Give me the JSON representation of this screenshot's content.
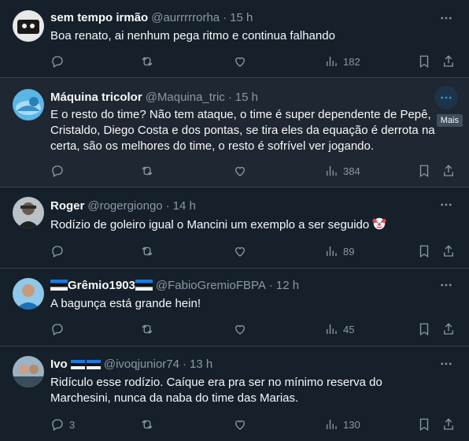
{
  "tooltip": "Mais",
  "tweets": [
    {
      "name": "sem tempo irmão",
      "handle": "@aurrrrrorha",
      "sep": "·",
      "time": "15 h",
      "text": "Boa renato, ai nenhum pega ritmo e continua falhando",
      "replies": "",
      "retweets": "",
      "likes": "",
      "views": "182"
    },
    {
      "name": "Máquina tricolor",
      "handle": "@Maquina_tric",
      "sep": "·",
      "time": "15 h",
      "text": "E o resto do time? Não tem ataque, o time é super dependente de Pepê, Cristaldo, Diego Costa e dos pontas, se tira eles da equação é derrota na certa, são os melhores do time, o resto é sofrível ver jogando.",
      "replies": "",
      "retweets": "",
      "likes": "",
      "views": "384"
    },
    {
      "name": "Roger",
      "handle": "@rogergiongo",
      "sep": "·",
      "time": "14 h",
      "text": "Rodízio de goleiro igual o Mancini um exemplo a ser seguido",
      "replies": "",
      "retweets": "",
      "likes": "",
      "views": "89"
    },
    {
      "name": "Grêmio1903",
      "handle": "@FabioGremioFBPA",
      "sep": "·",
      "time": "12 h",
      "text": "A bagunça está grande hein!",
      "replies": "",
      "retweets": "",
      "likes": "",
      "views": "45"
    },
    {
      "name": "Ivo",
      "handle": "@ivoqjunior74",
      "sep": "·",
      "time": "13 h",
      "text": "Ridículo esse rodízio. Caíque era pra ser no mínimo reserva do Marchesini, nunca da naba do time das Marias.",
      "replies": "3",
      "retweets": "",
      "likes": "",
      "views": "130"
    }
  ],
  "icons": {
    "reply": "reply-icon",
    "retweet": "retweet-icon",
    "like": "heart-icon",
    "views": "views-icon",
    "bookmark": "bookmark-icon",
    "share": "share-icon",
    "more": "more-icon"
  },
  "colors": {
    "background": "#15202b",
    "accent": "#1d9bf0",
    "muted": "#8b98a5"
  }
}
